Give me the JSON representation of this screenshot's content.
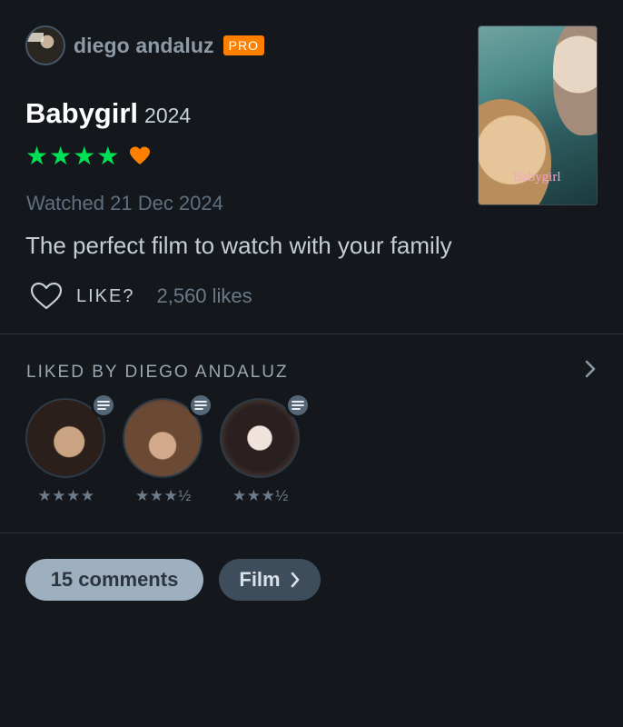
{
  "review": {
    "author": "diego andaluz",
    "author_badge": "PRO",
    "film_title": "Babygirl",
    "film_year": "2024",
    "rating_stars": "★★★★",
    "rating": 4,
    "liked": true,
    "watched_label": "Watched 21 Dec 2024",
    "text": "The perfect film to watch with your family",
    "like_label": "LIKE?",
    "likes_count": "2,560 likes",
    "poster_title": "Babygirl"
  },
  "liked_by": {
    "heading": "LIKED BY DIEGO ANDALUZ",
    "users": [
      {
        "stars": "★★★★",
        "rating": 4
      },
      {
        "stars": "★★★½",
        "rating": 3.5
      },
      {
        "stars": "★★★½",
        "rating": 3.5
      }
    ]
  },
  "actions": {
    "comments_label": "15 comments",
    "film_label": "Film"
  },
  "colors": {
    "background": "#14181c",
    "star_green": "#00e054",
    "heart_orange": "#ff8000",
    "pro_badge": "#ff8000"
  }
}
